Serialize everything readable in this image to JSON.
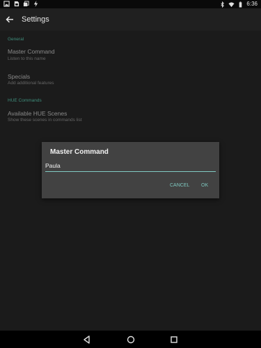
{
  "status_bar": {
    "time": "6:36",
    "left_icons": [
      "photo-notification-icon",
      "sim-notification-icon",
      "copy-notification-icon",
      "flash-notification-icon"
    ],
    "right_icons": [
      "bluetooth-icon",
      "wifi-icon",
      "battery-icon"
    ]
  },
  "toolbar": {
    "title": "Settings"
  },
  "settings": {
    "general_header": "General",
    "master_command_title": "Master Command",
    "master_command_summary": "Listen to this name",
    "specials_title": "Specials",
    "specials_summary": "Add additional features",
    "hue_header": "HUE Commands",
    "scenes_title": "Available HUE Scenes",
    "scenes_summary": "Show these scenes in commands list"
  },
  "dialog": {
    "title": "Master Command",
    "input_value": "Paula",
    "cancel_label": "CANCEL",
    "ok_label": "OK"
  },
  "colors": {
    "accent": "#80cbc4",
    "category": "#3f8e7c",
    "dialog_bg": "#424242",
    "app_bg": "#1b1b1b"
  }
}
